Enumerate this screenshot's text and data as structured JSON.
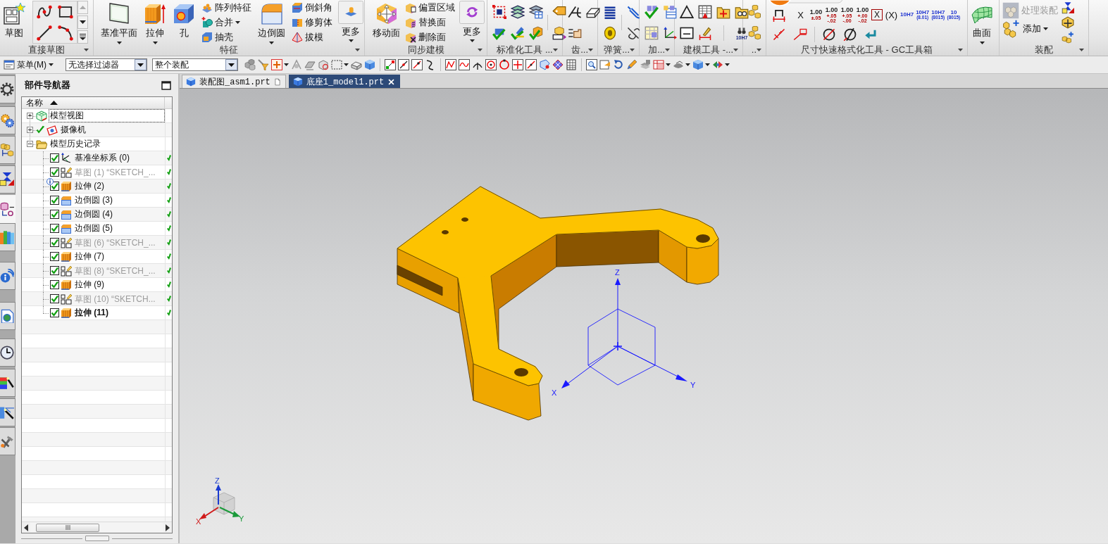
{
  "ribbon": {
    "groups": [
      {
        "label": "直接草图",
        "buttons": [
          {
            "label": "草图",
            "dropdown": false
          }
        ]
      },
      {
        "label": "特征",
        "buttons": [
          {
            "label": "基准平面",
            "dropdown": true
          },
          {
            "label": "拉伸",
            "dropdown": true
          },
          {
            "label": "孔",
            "dropdown": false
          },
          {
            "label": "阵列特征",
            "dropdown": false
          },
          {
            "label": "合并",
            "dropdown": true
          },
          {
            "label": "抽壳",
            "dropdown": false
          },
          {
            "label": "边倒圆",
            "dropdown": true
          },
          {
            "label": "倒斜角",
            "dropdown": false
          },
          {
            "label": "修剪体",
            "dropdown": false
          },
          {
            "label": "拔模",
            "dropdown": false
          },
          {
            "label": "更多",
            "dropdown": true
          }
        ]
      },
      {
        "label": "同步建模",
        "buttons": [
          {
            "label": "移动面",
            "dropdown": false
          },
          {
            "label": "偏置区域",
            "dropdown": false
          },
          {
            "label": "替换面",
            "dropdown": false
          },
          {
            "label": "删除面",
            "dropdown": false
          },
          {
            "label": "更多",
            "dropdown": true
          }
        ]
      },
      {
        "label": "标准化工具 ..."
      },
      {
        "label": "齿..."
      },
      {
        "label": "弹簧..."
      },
      {
        "label": "加..."
      },
      {
        "label": "建模工具 -...",
        "buttons": [
          {
            "label": "10H7"
          }
        ]
      },
      {
        "label": ".."
      },
      {
        "label": "尺寸快速格式化工具 - GC工具箱",
        "buttons": [
          {
            "kind": "plain",
            "lines": [
              "X"
            ]
          },
          {
            "kind": "tolerance",
            "lines": [
              "1.00",
              "±.05"
            ]
          },
          {
            "kind": "tolerance",
            "lines": [
              "1.00",
              "+.05",
              "-.02"
            ]
          },
          {
            "kind": "tolerance",
            "lines": [
              "1.00",
              "+.05",
              "-.00"
            ]
          },
          {
            "kind": "tolerance",
            "lines": [
              "1.00",
              "+.00",
              "-.02"
            ]
          },
          {
            "kind": "boxed",
            "lines": [
              "X"
            ]
          },
          {
            "kind": "plain",
            "lines": [
              "(X)"
            ]
          },
          {
            "kind": "fit",
            "lines": [
              "10H7"
            ]
          },
          {
            "kind": "fit",
            "lines": [
              "10H7",
              "(8.01)"
            ]
          },
          {
            "kind": "fit",
            "lines": [
              "10H7",
              "(8015)"
            ]
          },
          {
            "kind": "fit",
            "lines": [
              "10",
              "(8015)"
            ]
          }
        ]
      },
      {
        "buttons": [
          {
            "label": "曲面",
            "dropdown": true
          }
        ]
      },
      {
        "label": "装配",
        "buttons": [
          {
            "label": "处理装配",
            "disabled": true,
            "dropdown": false
          },
          {
            "label": "添加",
            "disabled": false,
            "dropdown": true
          }
        ]
      }
    ]
  },
  "toolbar": {
    "menu": {
      "label": "菜单(M)"
    },
    "filters": [
      {
        "value": "无选择过滤器"
      },
      {
        "value": "整个装配"
      }
    ]
  },
  "resource_bar": [
    {
      "selected": false
    },
    {
      "selected": false
    },
    {
      "selected": false
    },
    {
      "selected": false
    },
    {
      "selected": true
    },
    {
      "selected": false
    },
    {
      "selected": false
    },
    {
      "selected": false
    },
    {
      "selected": false
    },
    {
      "selected": false
    },
    {
      "selected": false
    },
    {
      "selected": false
    }
  ],
  "navigator": {
    "title": "部件导航器",
    "columns": [
      {
        "label": "名称",
        "sorted": true
      }
    ],
    "tree": [
      {
        "label": "模型视图",
        "kind": "views",
        "expanded": false,
        "focused": true,
        "ticked": false
      },
      {
        "label": "摄像机",
        "kind": "cameras",
        "expanded": false,
        "focused": false,
        "ticked": true
      },
      {
        "label": "模型历史记录",
        "kind": "history",
        "expanded": true,
        "focused": false,
        "ticked": false,
        "children": [
          {
            "label": "基准坐标系 (0)",
            "kind": "csys",
            "checked": true,
            "dimmed": false,
            "current": false,
            "info": false
          },
          {
            "label": "草图 (1) “SKETCH_...",
            "kind": "sketch",
            "checked": true,
            "dimmed": true,
            "current": false,
            "info": false
          },
          {
            "label": "拉伸 (2)",
            "kind": "extrude",
            "checked": true,
            "dimmed": false,
            "current": false,
            "info": true
          },
          {
            "label": "边倒圆 (3)",
            "kind": "blend",
            "checked": true,
            "dimmed": false,
            "current": false,
            "info": false
          },
          {
            "label": "边倒圆 (4)",
            "kind": "blend",
            "checked": true,
            "dimmed": false,
            "current": false,
            "info": false
          },
          {
            "label": "边倒圆 (5)",
            "kind": "blend",
            "checked": true,
            "dimmed": false,
            "current": false,
            "info": false
          },
          {
            "label": "草图 (6) “SKETCH_...",
            "kind": "sketch",
            "checked": true,
            "dimmed": true,
            "current": false,
            "info": false
          },
          {
            "label": "拉伸 (7)",
            "kind": "extrude",
            "checked": true,
            "dimmed": false,
            "current": false,
            "info": false
          },
          {
            "label": "草图 (8) “SKETCH_...",
            "kind": "sketch",
            "checked": true,
            "dimmed": true,
            "current": false,
            "info": false
          },
          {
            "label": "拉伸 (9)",
            "kind": "extrude",
            "checked": true,
            "dimmed": false,
            "current": false,
            "info": false
          },
          {
            "label": "草图 (10) “SKETCH...",
            "kind": "sketch",
            "checked": true,
            "dimmed": true,
            "current": false,
            "info": false
          },
          {
            "label": "拉伸 (11)",
            "kind": "extrude",
            "checked": true,
            "dimmed": false,
            "current": true,
            "info": false
          }
        ]
      }
    ]
  },
  "tabs": [
    {
      "label": "装配图_asm1.prt",
      "selected": false
    },
    {
      "label": "底座1_model1.prt",
      "selected": true
    }
  ],
  "viewport": {
    "datum_csys": {
      "x_label": "X",
      "y_label": "Y",
      "z_label": "Z"
    },
    "view_triad": {
      "x_label": "X",
      "y_label": "Y",
      "z_label": "Z"
    }
  }
}
